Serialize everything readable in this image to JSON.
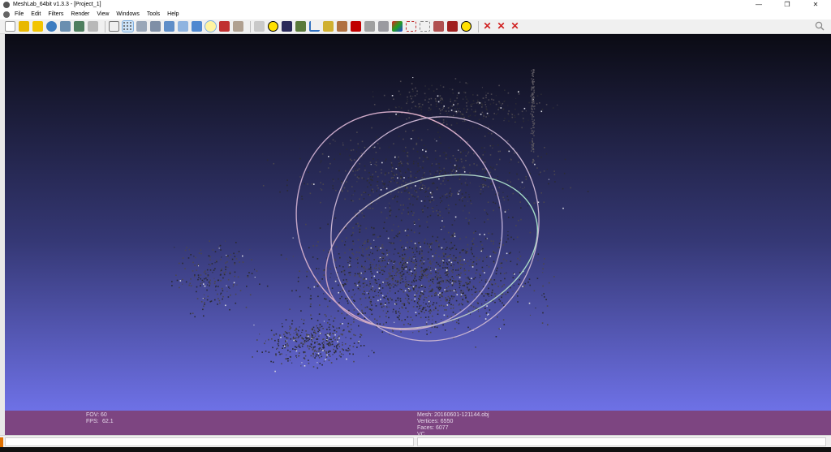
{
  "window": {
    "title": "MeshLab_64bit v1.3.3 - [Project_1]",
    "minimize": "—",
    "restore": "❐",
    "close": "✕"
  },
  "menu": {
    "items": [
      {
        "label": "File"
      },
      {
        "label": "Edit"
      },
      {
        "label": "Filters"
      },
      {
        "label": "Render"
      },
      {
        "label": "View"
      },
      {
        "label": "Windows"
      },
      {
        "label": "Tools"
      },
      {
        "label": "Help"
      }
    ]
  },
  "toolbar": {
    "icons": [
      "new-document-icon",
      "open-project-icon",
      "import-mesh-icon",
      "reload-icon",
      "export-mesh-icon",
      "snapshot-icon",
      "print-icon",
      "bounding-box-icon",
      "points-icon",
      "wireframe-icon",
      "hidden-lines-icon",
      "flat-lines-icon",
      "flat-icon",
      "smooth-icon",
      "light-icon",
      "texture-icon",
      "color-icon",
      "manipulator-icon",
      "measure-icon",
      "raster-icon",
      "align-icon",
      "normals-icon",
      "paint-icon",
      "brush-icon",
      "select-faces-icon",
      "select-vertices-icon",
      "color-paint-icon",
      "select-connected-icon",
      "select-region-icon",
      "quoted-box-icon",
      "info-icon",
      "delete-faces-icon",
      "delete-vertices-icon",
      "delete-both-icon"
    ],
    "accent_blue": "#cde3f7"
  },
  "viewport": {
    "gradient_top": "#0b0b14",
    "gradient_mid": "#353875",
    "gradient_bottom": "#6e71e6"
  },
  "info": {
    "fov_label": "FOV: 60",
    "fps_label": "FPS:",
    "fps_value": "62.1",
    "mesh_line": "Mesh: 20160601-121144.obj",
    "vertices_line": "Vertices: 6550",
    "faces_line": "Faces: 6077",
    "vc_line": "VC"
  },
  "colors": {
    "info_panel": "#7d4581"
  }
}
